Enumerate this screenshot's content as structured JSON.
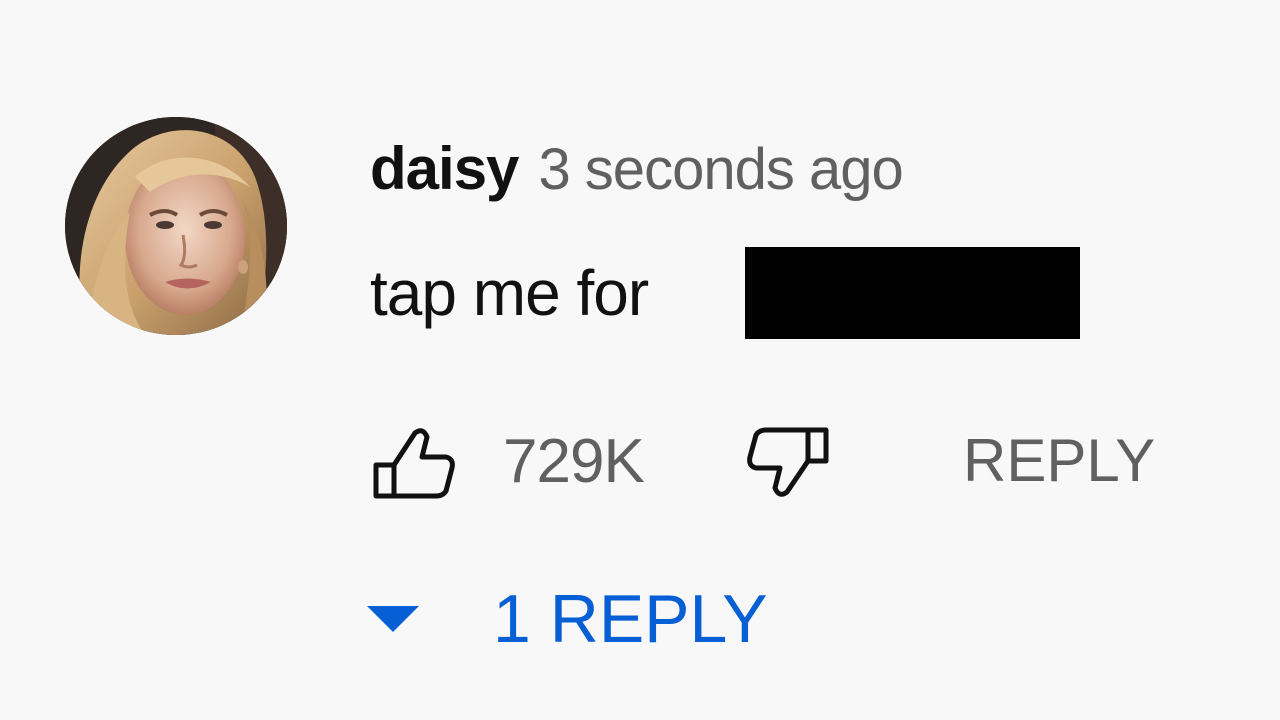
{
  "comment": {
    "author": "daisy",
    "timestamp": "3 seconds ago",
    "text": "tap me for",
    "like_count": "729K",
    "reply_label": "REPLY",
    "replies_label": "1 REPLY"
  },
  "icons": {
    "like": "thumbs-up-outline-icon",
    "dislike": "thumbs-down-outline-icon",
    "expand": "caret-down-icon"
  },
  "colors": {
    "background": "#f8f8f8",
    "primary_text": "#111111",
    "secondary_text": "#606060",
    "link_blue": "#065fd4",
    "redaction": "#000000"
  }
}
